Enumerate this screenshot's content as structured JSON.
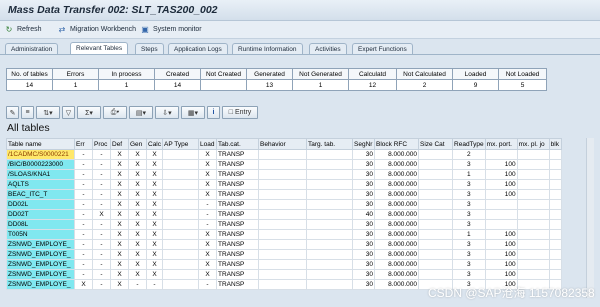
{
  "title": "Mass Data Transfer 002: SLT_TAS200_002",
  "toolbar": {
    "refresh": "Refresh",
    "migration": "Migration Workbench",
    "sysmon": "System monitor"
  },
  "tabs": [
    "Administration",
    "Relevant Tables",
    "Steps",
    "Application Logs",
    "Runtime Information",
    "Activities",
    "Expert Functions"
  ],
  "stats": {
    "headers": [
      "No. of tables",
      "Errors",
      "In process",
      "Created",
      "Not Created",
      "Generated",
      "Not Generated",
      "Calculatd",
      "Not Calculated",
      "Loaded",
      "Not Loaded"
    ],
    "values": [
      "14",
      "1",
      "1",
      "14",
      "",
      "13",
      "1",
      "12",
      "2",
      "9",
      "5"
    ]
  },
  "actions": {
    "entry": "Entry"
  },
  "heading": "All tables",
  "grid": {
    "headers": [
      "Table name",
      "Err",
      "Proc",
      "Def",
      "Gen",
      "Calc",
      "AP Type",
      "Load",
      "Tab.cat.",
      "Behavior",
      "Targ. tab.",
      "SegNr",
      "Block RFC",
      "Size Cat",
      "ReadType",
      "mx. port.",
      "mx. pl. jo",
      "blk"
    ],
    "rows": [
      [
        "/1CADMC/S0000221",
        "-",
        "-",
        "X",
        "X",
        "X",
        "",
        "X",
        "TRANSP",
        "",
        "",
        "30",
        "8.000.000",
        "",
        "2",
        "",
        "",
        ""
      ],
      [
        "/BIC/B0000223000",
        "-",
        "-",
        "X",
        "X",
        "X",
        "",
        "X",
        "TRANSP",
        "",
        "",
        "30",
        "8.000.000",
        "",
        "3",
        "100",
        "",
        ""
      ],
      [
        "/SLOAS/KNA1",
        "-",
        "-",
        "X",
        "X",
        "X",
        "",
        "X",
        "TRANSP",
        "",
        "",
        "30",
        "8.000.000",
        "",
        "1",
        "100",
        "",
        ""
      ],
      [
        "AQLTS",
        "-",
        "-",
        "X",
        "X",
        "X",
        "",
        "X",
        "TRANSP",
        "",
        "",
        "30",
        "8.000.000",
        "",
        "3",
        "100",
        "",
        ""
      ],
      [
        "BEAC_ITC_T",
        "-",
        "-",
        "X",
        "X",
        "X",
        "",
        "X",
        "TRANSP",
        "",
        "",
        "30",
        "8.000.000",
        "",
        "3",
        "100",
        "",
        ""
      ],
      [
        "DD02L",
        "-",
        "-",
        "X",
        "X",
        "X",
        "",
        "-",
        "TRANSP",
        "",
        "",
        "30",
        "8.000.000",
        "",
        "3",
        "",
        "",
        ""
      ],
      [
        "DD02T",
        "-",
        "X",
        "X",
        "X",
        "X",
        "",
        "-",
        "TRANSP",
        "",
        "",
        "40",
        "8.000.000",
        "",
        "3",
        "",
        "",
        ""
      ],
      [
        "DD08L",
        "-",
        "-",
        "X",
        "X",
        "X",
        "",
        "-",
        "TRANSP",
        "",
        "",
        "30",
        "8.000.000",
        "",
        "3",
        "",
        "",
        ""
      ],
      [
        "T005N",
        "-",
        "-",
        "X",
        "X",
        "X",
        "",
        "X",
        "TRANSP",
        "",
        "",
        "30",
        "8.000.000",
        "",
        "1",
        "100",
        "",
        ""
      ],
      [
        "ZSNWD_EMPLOYE_",
        "-",
        "-",
        "X",
        "X",
        "X",
        "",
        "X",
        "TRANSP",
        "",
        "",
        "30",
        "8.000.000",
        "",
        "3",
        "100",
        "",
        ""
      ],
      [
        "ZSNWD_EMPLOYE_",
        "-",
        "-",
        "X",
        "X",
        "X",
        "",
        "X",
        "TRANSP",
        "",
        "",
        "30",
        "8.000.000",
        "",
        "3",
        "100",
        "",
        ""
      ],
      [
        "ZSNWD_EMPLOYE_",
        "-",
        "-",
        "X",
        "X",
        "X",
        "",
        "X",
        "TRANSP",
        "",
        "",
        "30",
        "8.000.000",
        "",
        "3",
        "100",
        "",
        ""
      ],
      [
        "ZSNWD_EMPLOYE_",
        "-",
        "-",
        "X",
        "X",
        "X",
        "",
        "X",
        "TRANSP",
        "",
        "",
        "30",
        "8.000.000",
        "",
        "3",
        "100",
        "",
        ""
      ],
      [
        "ZSNWD_EMPLOYE_",
        "X",
        "-",
        "X",
        "-",
        "-",
        "",
        "-",
        "TRANSP",
        "",
        "",
        "30",
        "8.000.000",
        "",
        "3",
        "100",
        "",
        ""
      ]
    ]
  },
  "watermark": "CSDN @SAP沧海 1157082358",
  "colors": {
    "key_cell": "#80e8f0",
    "selected_cell": "#ffe86b"
  },
  "icons": [
    "refresh-icon",
    "migration-workbench-icon",
    "system-monitor-icon"
  ]
}
